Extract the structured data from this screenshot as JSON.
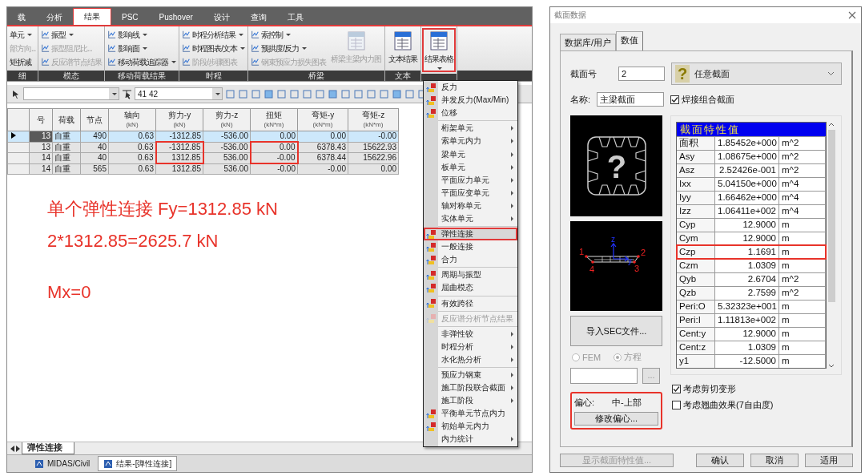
{
  "results_window": {
    "tabs": [
      {
        "label": "载",
        "selected": false
      },
      {
        "label": "分析",
        "selected": false
      },
      {
        "label": "结果",
        "selected": true
      },
      {
        "label": "PSC",
        "selected": false
      },
      {
        "label": "Pushover",
        "selected": false
      },
      {
        "label": "设计",
        "selected": false
      },
      {
        "label": "查询",
        "selected": false
      },
      {
        "label": "工具",
        "selected": false
      }
    ],
    "ribbon": [
      {
        "title": "细",
        "items": [
          {
            "kind": "cut",
            "label": "单元",
            "dropdown": true,
            "disabled": false
          },
          {
            "kind": "cut",
            "label": "部方向...",
            "dropdown": false,
            "disabled": true
          },
          {
            "kind": "cut",
            "label": "矩折减",
            "dropdown": false,
            "disabled": false
          }
        ]
      },
      {
        "title": "模态",
        "items": [
          {
            "kind": "small",
            "label": "振型",
            "dropdown": true,
            "disabled": false
          },
          {
            "kind": "small",
            "label": "振型阻尼比...",
            "dropdown": false,
            "disabled": true
          },
          {
            "kind": "small",
            "label": "反应谱节点结果",
            "dropdown": false,
            "disabled": true
          }
        ]
      },
      {
        "title": "移动荷载结果",
        "items": [
          {
            "kind": "small",
            "label": "影响线",
            "dropdown": true,
            "disabled": false
          },
          {
            "kind": "small",
            "label": "影响面",
            "dropdown": true,
            "disabled": false
          },
          {
            "kind": "small",
            "label": "移动荷载追踪器",
            "dropdown": true,
            "disabled": false
          }
        ]
      },
      {
        "title": "时程",
        "items": [
          {
            "kind": "small",
            "label": "时程分析结果",
            "dropdown": true,
            "disabled": false
          },
          {
            "kind": "small",
            "label": "时程图表/文本",
            "dropdown": true,
            "disabled": false
          },
          {
            "kind": "small",
            "label": "阶段/步骤图表",
            "dropdown": false,
            "disabled": true
          }
        ]
      },
      {
        "title": "桥梁",
        "items": [
          {
            "kind": "small",
            "label": "索控制",
            "dropdown": true,
            "disabled": false
          },
          {
            "kind": "small",
            "label": "预拱度/反力",
            "dropdown": true,
            "disabled": false
          },
          {
            "kind": "small",
            "label": "钢束预应力损失图表",
            "dropdown": false,
            "disabled": true
          },
          {
            "kind": "large",
            "label": "桥梁主梁内力图",
            "dropdown": false,
            "disabled": true
          }
        ]
      },
      {
        "title": "文本",
        "items": [
          {
            "kind": "large",
            "label": "文本结果",
            "dropdown": false,
            "disabled": false
          }
        ]
      },
      {
        "items": [
          {
            "kind": "large",
            "label": "结果表格",
            "dropdown": true,
            "disabled": false,
            "boxed": true
          }
        ]
      }
    ],
    "toolbar": {
      "node_field": "41 42"
    },
    "table": {
      "columns": [
        {
          "label": "号"
        },
        {
          "label": "荷载"
        },
        {
          "label": "节点"
        },
        {
          "label": "轴向",
          "unit": "(kN)"
        },
        {
          "label": "剪力-y",
          "unit": "(kN)"
        },
        {
          "label": "剪力-z",
          "unit": "(kN)"
        },
        {
          "label": "扭矩",
          "unit": "(kN*m)"
        },
        {
          "label": "弯矩-y",
          "unit": "(kN*m)"
        },
        {
          "label": "弯矩-z",
          "unit": "(kN*m)"
        }
      ],
      "rows": [
        {
          "selected": true,
          "cells": [
            {
              "text": "13",
              "boxed": false
            },
            {
              "text": "自重",
              "boxed": false
            },
            {
              "text": "490",
              "boxed": false
            },
            {
              "text": "0.63",
              "boxed": false
            },
            {
              "text": "-1312.85",
              "boxed": false
            },
            {
              "text": "-536.00",
              "boxed": false
            },
            {
              "text": "0.00",
              "boxed": false
            },
            {
              "text": "0.00",
              "boxed": false
            },
            {
              "text": "-0.00",
              "boxed": false
            }
          ]
        },
        {
          "selected": false,
          "cells": [
            {
              "text": "13",
              "boxed": false
            },
            {
              "text": "自重",
              "boxed": false
            },
            {
              "text": "40",
              "boxed": false
            },
            {
              "text": "0.63",
              "boxed": false
            },
            {
              "text": "-1312.85",
              "boxed": true
            },
            {
              "text": "-536.00",
              "boxed": false
            },
            {
              "text": "0.00",
              "boxed": true
            },
            {
              "text": "6378.43",
              "boxed": false
            },
            {
              "text": "15622.93",
              "boxed": false
            }
          ]
        },
        {
          "selected": false,
          "cells": [
            {
              "text": "14",
              "boxed": false
            },
            {
              "text": "自重",
              "boxed": false
            },
            {
              "text": "40",
              "boxed": false
            },
            {
              "text": "0.63",
              "boxed": false
            },
            {
              "text": "1312.85",
              "boxed": true
            },
            {
              "text": "536.00",
              "boxed": false
            },
            {
              "text": "-0.00",
              "boxed": true
            },
            {
              "text": "6378.44",
              "boxed": false
            },
            {
              "text": "15622.96",
              "boxed": false
            }
          ]
        },
        {
          "selected": false,
          "cells": [
            {
              "text": "14",
              "boxed": false
            },
            {
              "text": "自重",
              "boxed": false
            },
            {
              "text": "565",
              "boxed": false
            },
            {
              "text": "0.63",
              "boxed": false
            },
            {
              "text": "1312.85",
              "boxed": false
            },
            {
              "text": "536.00",
              "boxed": false
            },
            {
              "text": "-0.00",
              "boxed": false
            },
            {
              "text": "-0.00",
              "boxed": false
            },
            {
              "text": "0.00",
              "boxed": false
            }
          ]
        }
      ]
    },
    "annotations": [
      "单个弹性连接 Fy=1312.85 kN",
      "2*1312.85=2625.7 kN",
      "Mx=0"
    ],
    "sheet_tab": "弹性连接",
    "taskbar": [
      {
        "label": "MIDAS/Civil",
        "selected": false
      },
      {
        "label": "结果-[弹性连接]",
        "selected": true
      }
    ]
  },
  "result_menu": {
    "sections": [
      [
        {
          "kind": "command",
          "label": "反力",
          "selected": false,
          "disabled": false
        },
        {
          "kind": "command",
          "label": "并发反力(Max/Min)",
          "selected": false,
          "disabled": false
        },
        {
          "kind": "command",
          "label": "位移",
          "selected": false,
          "disabled": false
        }
      ],
      [
        {
          "kind": "submenu",
          "label": "桁架单元",
          "selected": false,
          "disabled": false
        },
        {
          "kind": "submenu",
          "label": "索单元内力",
          "selected": false,
          "disabled": false
        },
        {
          "kind": "submenu",
          "label": "梁单元",
          "selected": false,
          "disabled": false
        },
        {
          "kind": "submenu",
          "label": "板单元",
          "selected": false,
          "disabled": false
        },
        {
          "kind": "submenu",
          "label": "平面应力单元",
          "selected": false,
          "disabled": false
        },
        {
          "kind": "submenu",
          "label": "平面应变单元",
          "selected": false,
          "disabled": false
        },
        {
          "kind": "submenu",
          "label": "轴对称单元",
          "selected": false,
          "disabled": false
        },
        {
          "kind": "submenu",
          "label": "实体单元",
          "selected": false,
          "disabled": false
        }
      ],
      [
        {
          "kind": "command",
          "label": "弹性连接",
          "selected": true,
          "disabled": false
        },
        {
          "kind": "command",
          "label": "一般连接",
          "selected": false,
          "disabled": false
        },
        {
          "kind": "command",
          "label": "合力",
          "selected": false,
          "disabled": false
        }
      ],
      [
        {
          "kind": "command",
          "label": "周期与振型",
          "selected": false,
          "disabled": false
        },
        {
          "kind": "command",
          "label": "屈曲模态",
          "selected": false,
          "disabled": false
        }
      ],
      [
        {
          "kind": "command",
          "label": "有效跨径",
          "selected": false,
          "disabled": false
        }
      ],
      [
        {
          "kind": "command",
          "label": "反应谱分析节点结果",
          "selected": false,
          "disabled": true
        }
      ],
      [
        {
          "kind": "submenu",
          "label": "非弹性铰",
          "selected": false,
          "disabled": false
        },
        {
          "kind": "submenu",
          "label": "时程分析",
          "selected": false,
          "disabled": false
        },
        {
          "kind": "submenu",
          "label": "水化热分析",
          "selected": false,
          "disabled": false
        }
      ],
      [
        {
          "kind": "submenu",
          "label": "预应力钢束",
          "selected": false,
          "disabled": false
        },
        {
          "kind": "submenu",
          "label": "施工阶段联合截面",
          "selected": false,
          "disabled": false
        },
        {
          "kind": "submenu",
          "label": "施工阶段",
          "selected": false,
          "disabled": false
        },
        {
          "kind": "command",
          "label": "平衡单元节点内力",
          "selected": false,
          "disabled": false
        },
        {
          "kind": "command",
          "label": "初始单元内力",
          "selected": false,
          "disabled": false
        },
        {
          "kind": "submenu",
          "label": "内力统计",
          "selected": false,
          "disabled": false
        }
      ]
    ]
  },
  "section_dialog": {
    "title": "截面数据",
    "tabs": [
      {
        "label": "数据库/用户",
        "selected": false
      },
      {
        "label": "数值",
        "selected": true
      }
    ],
    "section_number": {
      "label": "截面号",
      "value": "2"
    },
    "section_type": {
      "symbol": "?",
      "value": "任意截面"
    },
    "name": {
      "label": "名称:",
      "value": "主梁截面"
    },
    "welded": {
      "label": "焊接组合截面",
      "checked": true
    },
    "preview_symbol": "?",
    "section_drawing": {
      "point_labels": [
        "1",
        "2",
        "3",
        "4"
      ],
      "axis_labels": [
        "z",
        "y"
      ]
    },
    "import_button": "导入SEC文件...",
    "methods": [
      {
        "label": "FEM",
        "selected": false,
        "disabled": true
      },
      {
        "label": "方程",
        "selected": true,
        "disabled": true
      }
    ],
    "browse_button": "...",
    "offset": {
      "label": "偏心:",
      "value": "中-上部",
      "button": "修改偏心...",
      "boxed": true
    },
    "properties": {
      "title": "截面特性值",
      "rows": [
        {
          "name": "面积",
          "value": "1.85452e+000",
          "unit": "m^2",
          "boxed": false
        },
        {
          "name": "Asy",
          "value": "1.08675e+000",
          "unit": "m^2",
          "boxed": false
        },
        {
          "name": "Asz",
          "value": "2.52426e-001",
          "unit": "m^2",
          "boxed": false
        },
        {
          "name": "Ixx",
          "value": "5.04150e+000",
          "unit": "m^4",
          "boxed": false
        },
        {
          "name": "Iyy",
          "value": "1.66462e+000",
          "unit": "m^4",
          "boxed": false
        },
        {
          "name": "Izz",
          "value": "1.06411e+002",
          "unit": "m^4",
          "boxed": false
        },
        {
          "name": "Cyp",
          "value": "12.9000",
          "unit": "m",
          "boxed": false
        },
        {
          "name": "Cym",
          "value": "12.9000",
          "unit": "m",
          "boxed": false
        },
        {
          "name": "Czp",
          "value": "1.1691",
          "unit": "m",
          "boxed": true
        },
        {
          "name": "Czm",
          "value": "1.0309",
          "unit": "m",
          "boxed": false
        },
        {
          "name": "Qyb",
          "value": "2.6704",
          "unit": "m^2",
          "boxed": false
        },
        {
          "name": "Qzb",
          "value": "2.7599",
          "unit": "m^2",
          "boxed": false
        },
        {
          "name": "Peri:O",
          "value": "5.32323e+001",
          "unit": "m",
          "boxed": false
        },
        {
          "name": "Peri:I",
          "value": "1.11813e+002",
          "unit": "m",
          "boxed": false
        },
        {
          "name": "Cent:y",
          "value": "12.9000",
          "unit": "m",
          "boxed": false
        },
        {
          "name": "Cent:z",
          "value": "1.0309",
          "unit": "m",
          "boxed": false
        },
        {
          "name": "y1",
          "value": "-12.5000",
          "unit": "m",
          "boxed": false
        }
      ]
    },
    "options": [
      {
        "label": "考虑剪切变形",
        "checked": true
      },
      {
        "label": "考虑翘曲效果(7自由度)",
        "checked": false
      }
    ],
    "buttons": [
      {
        "label": "显示截面特性值...",
        "disabled": true
      },
      {
        "label": "确认",
        "disabled": false
      },
      {
        "label": "取消",
        "disabled": false
      },
      {
        "label": "适用",
        "disabled": false
      }
    ]
  }
}
